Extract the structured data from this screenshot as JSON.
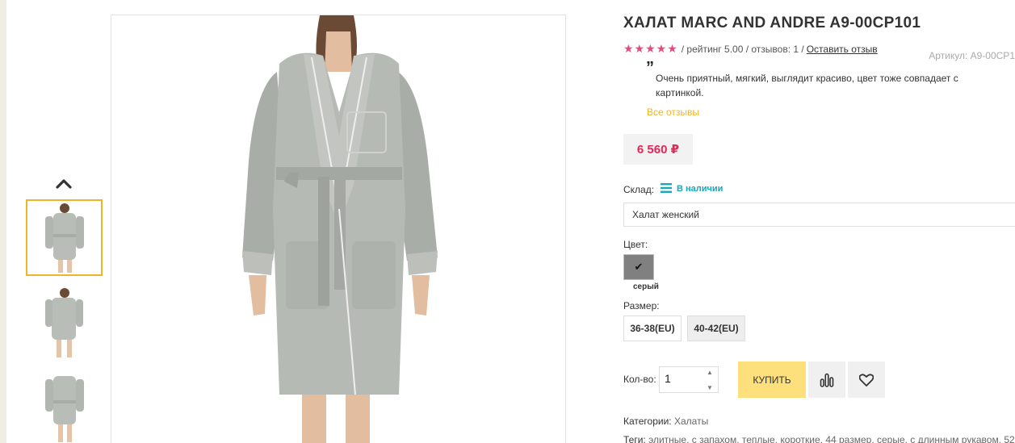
{
  "gallery": {
    "thumbnails": [
      {
        "name": "thumbnail-1",
        "active": true
      },
      {
        "name": "thumbnail-2",
        "active": false
      },
      {
        "name": "thumbnail-3",
        "active": false
      }
    ]
  },
  "product": {
    "title": "ХАЛАТ MARC AND ANDRE A9-00CP101",
    "stars": "★★★★★",
    "rating_text": "/ рейтинг 5.00 / отзывов: 1 /",
    "leave_review": "Оставить отзыв",
    "article": "Артикул: A9-00CP1",
    "review_quote": "Очень приятный, мягкий, выглядит красиво, цвет тоже совпадает с картинкой.",
    "all_reviews": "Все отзывы",
    "price": "6 560 ₽",
    "stock_label": "Склад:",
    "stock_value": "В наличии",
    "variant": "Халат женский",
    "color_label": "Цвет:",
    "color_name": "серый",
    "size_label": "Размер:",
    "sizes": [
      "36-38(EU)",
      "40-42(EU)"
    ],
    "qty_label": "Кол-во:",
    "qty_value": "1",
    "buy_label": "КУПИТЬ",
    "categories_label": "Категории:",
    "categories_value": "Халаты",
    "tags_label": "Теги:",
    "tags_value": "элитные, с запахом, теплые, короткие, 44 размер, серые, с длинным рукавом, 52"
  },
  "colors": {
    "accent": "#f0b429",
    "price": "#e0285a",
    "stars": "#e54b7b",
    "stock": "#1aa7b8",
    "buy_button": "#fde07b",
    "swatch_grey": "#808080"
  }
}
